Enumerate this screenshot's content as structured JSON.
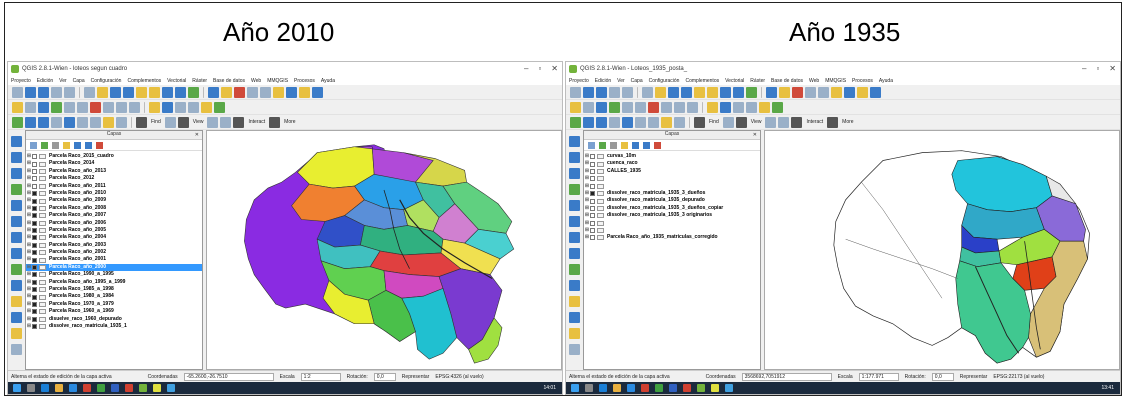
{
  "captions": {
    "left": "Año 2010",
    "right": "Año 1935"
  },
  "windows": [
    {
      "title": "QGIS 2.8.1-Wien - loteos segun cuadro",
      "menu": [
        "Proyecto",
        "Edición",
        "Ver",
        "Capa",
        "Configuración",
        "Complementos",
        "Vectorial",
        "Ráster",
        "Base de datos",
        "Web",
        "MMQGIS",
        "Procesos",
        "Ayuda"
      ],
      "toolbar_text": {
        "find": "Find",
        "view": "View",
        "interact": "Interact",
        "more": "More"
      },
      "layers_panel_title": "Capas",
      "layers": [
        {
          "name": "Parcela Raco_2015_cuadro",
          "checked": false,
          "selected": false
        },
        {
          "name": "Parcela Raco_2014",
          "checked": false,
          "selected": false
        },
        {
          "name": "Parcela Raco_año_2013",
          "checked": false,
          "selected": false
        },
        {
          "name": "Parcela Raco_2012",
          "checked": false,
          "selected": false
        },
        {
          "name": "Parcela Raco_año_2011",
          "checked": false,
          "selected": false
        },
        {
          "name": "Parcela Raco_año_2010",
          "checked": true,
          "selected": false
        },
        {
          "name": "Parcela Raco_año_2009",
          "checked": true,
          "selected": false
        },
        {
          "name": "Parcela Raco_año_2008",
          "checked": true,
          "selected": false
        },
        {
          "name": "Parcela Raco_año_2007",
          "checked": true,
          "selected": false
        },
        {
          "name": "Parcela Raco_año_2006",
          "checked": true,
          "selected": false
        },
        {
          "name": "Parcela Raco_año_2005",
          "checked": true,
          "selected": false
        },
        {
          "name": "Parcela Raco_año_2004",
          "checked": true,
          "selected": false
        },
        {
          "name": "Parcela Raco_año_2003",
          "checked": true,
          "selected": false
        },
        {
          "name": "Parcela Raco_año_2002",
          "checked": true,
          "selected": false
        },
        {
          "name": "Parcela Raco_año_2001",
          "checked": true,
          "selected": false
        },
        {
          "name": "Parcela Raco_año_2000",
          "checked": true,
          "selected": true
        },
        {
          "name": "Parcela Raco_1990_a_1995",
          "checked": true,
          "selected": false
        },
        {
          "name": "Parcela Raco_año_1995_a_1999",
          "checked": true,
          "selected": false
        },
        {
          "name": "Parcela Raco_1985_a_1998",
          "checked": true,
          "selected": false
        },
        {
          "name": "Parcela Raco_1980_a_1984",
          "checked": true,
          "selected": false
        },
        {
          "name": "Parcela Raco_1970_a_1979",
          "checked": true,
          "selected": false
        },
        {
          "name": "Parcela Raco_1960_a_1969",
          "checked": true,
          "selected": false
        },
        {
          "name": "disuelve_raco_1960_depurado",
          "checked": true,
          "selected": false
        },
        {
          "name": "dissolve_raco_matricula_1935_1",
          "checked": true,
          "selected": false
        }
      ],
      "status": {
        "hint": "Alterna el estado de edición de la capa activa",
        "coord_label": "Coordenadas",
        "coord_value": "-65.2600,-26.7510",
        "scale_label": "Escala",
        "scale_value": "1:2",
        "rotation_label": "Rotación:",
        "rotation_value": "0,0",
        "render_label": "Representar",
        "crs": "EPSG:4326 (al vuelo)"
      },
      "clock": "14:01"
    },
    {
      "title": "QGIS 2.8.1-Wien - Loteos_1935_posta_",
      "menu": [
        "Proyecto",
        "Edición",
        "Ver",
        "Capa",
        "Configuración",
        "Complementos",
        "Vectorial",
        "Ráster",
        "Base de datos",
        "Web",
        "MMQGIS",
        "Procesos",
        "Ayuda"
      ],
      "toolbar_text": {
        "find": "Find",
        "view": "View",
        "interact": "Interact",
        "more": "More"
      },
      "layers_panel_title": "Capas",
      "layers": [
        {
          "name": "curvas_10m",
          "checked": false,
          "selected": false
        },
        {
          "name": "cuenca_raco",
          "checked": false,
          "selected": false
        },
        {
          "name": "CALLES_1935",
          "checked": false,
          "selected": false
        },
        {
          "name": "",
          "checked": false,
          "selected": false
        },
        {
          "name": "",
          "checked": false,
          "selected": false
        },
        {
          "name": "dissolve_raco_matricula_1935_3_dueños",
          "checked": true,
          "selected": false
        },
        {
          "name": "dissolve_raco_matricula_1935_depurado",
          "checked": false,
          "selected": false
        },
        {
          "name": "dissolve_raco_matricula_1935_3_dueños_copiar",
          "checked": false,
          "selected": false
        },
        {
          "name": "dissolve_raco_matricula_1935_3 originarios",
          "checked": false,
          "selected": false
        },
        {
          "name": "",
          "checked": false,
          "selected": false
        },
        {
          "name": "",
          "checked": false,
          "selected": false
        },
        {
          "name": "Parcela Raco_año_1935_matriculas_corregido",
          "checked": false,
          "selected": false
        }
      ],
      "status": {
        "hint": "Alterna el estado de edición de la capa activa",
        "coord_label": "Coordenadas",
        "coord_value": "3568692,7051912",
        "scale_label": "Escala",
        "scale_value": "1:177.971",
        "rotation_label": "Rotación:",
        "rotation_value": "0,0",
        "render_label": "Representar",
        "crs": "EPSG:22173 (al vuelo)"
      },
      "clock": "13:41"
    }
  ]
}
